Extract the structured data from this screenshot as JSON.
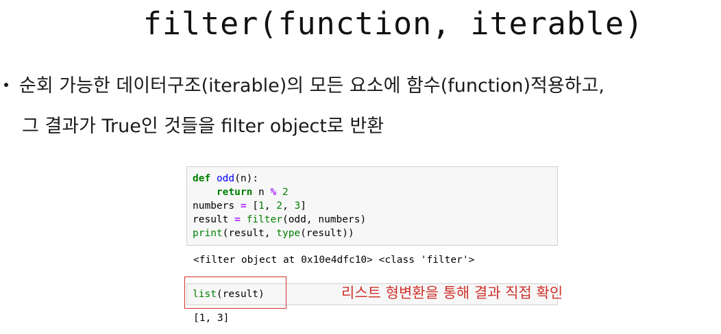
{
  "title": "filter(function, iterable)",
  "bullet": {
    "line1": "순회 가능한 데이터구조(iterable)의 모든 요소에 함수(function)적용하고,",
    "line2": "그 결과가 True인 것들을 filter object로 반환"
  },
  "cell1": {
    "line1": {
      "kw": "def",
      "name": "odd",
      "rest": "(n):"
    },
    "line2": {
      "indent": "    ",
      "kw": "return",
      "a": " n ",
      "op": "%",
      "b": " ",
      "num": "2"
    },
    "line3": {
      "a": "numbers ",
      "op": "=",
      "b": " [",
      "n1": "1",
      "c1": ", ",
      "n2": "2",
      "c2": ", ",
      "n3": "3",
      "end": "]"
    },
    "line4": {
      "a": "result ",
      "op": "=",
      "b": " ",
      "fn": "filter",
      "rest": "(odd, numbers)"
    },
    "line5": {
      "fn1": "print",
      "mid": "(result, ",
      "fn2": "type",
      "rest": "(result))"
    }
  },
  "output1": "<filter object at 0x10e4dfc10> <class 'filter'>",
  "cell2": {
    "fn": "list",
    "rest": "(result)"
  },
  "annotation": "리스트 형변환을 통해 결과 직접 확인",
  "output2": "[1, 3]",
  "colors": {
    "keyword": "#008000",
    "function_name": "#0000ff",
    "operator": "#aa22ff",
    "annotation": "#d0302a"
  }
}
